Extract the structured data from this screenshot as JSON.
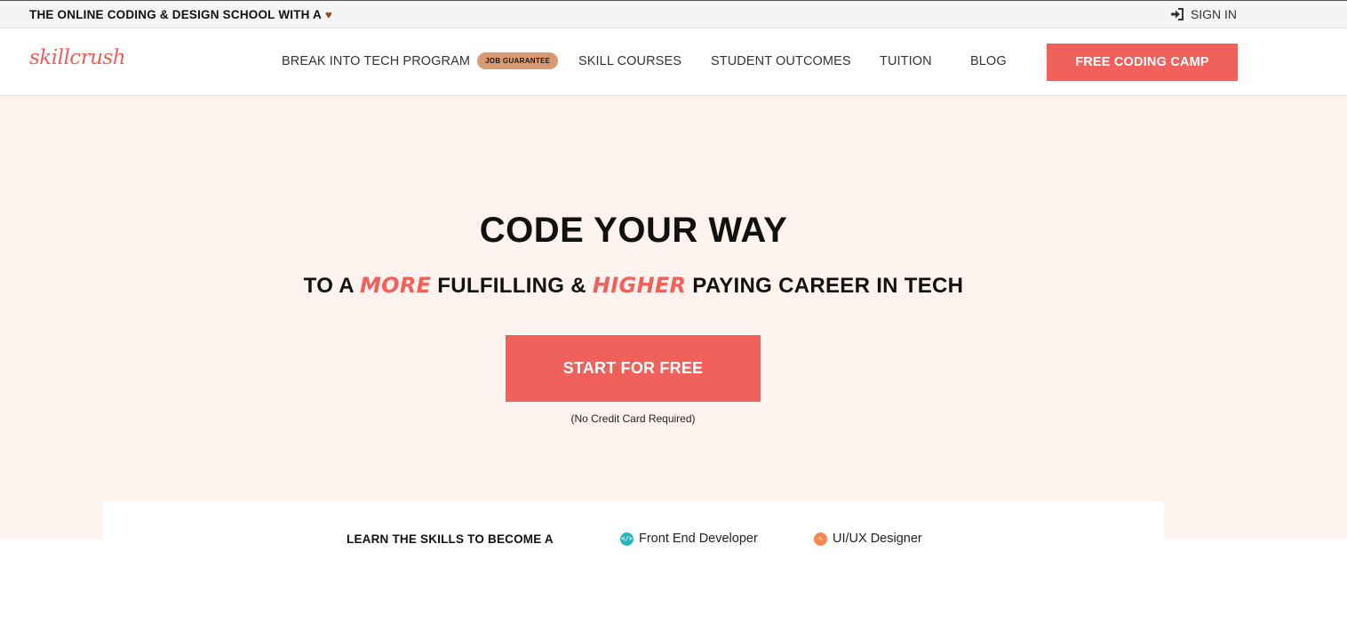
{
  "topbar": {
    "announcement": "THE ONLINE CODING & DESIGN SCHOOL WITH A",
    "heart_glyph": "♥",
    "signin_label": "SIGN IN"
  },
  "nav": {
    "logo": "skillcrush",
    "items": [
      {
        "label": "BREAK INTO TECH PROGRAM",
        "badge": "JOB GUARANTEE"
      },
      {
        "label": "SKILL COURSES"
      },
      {
        "label": "STUDENT OUTCOMES"
      },
      {
        "label": "TUITION"
      },
      {
        "label": "BLOG"
      }
    ],
    "cta_label": "FREE CODING CAMP"
  },
  "hero": {
    "title": "CODE YOUR WAY",
    "subtitle_part1": "TO A ",
    "subtitle_accent1": "MORE",
    "subtitle_part2": " FULFILLING & ",
    "subtitle_accent2": "HIGHER",
    "subtitle_part3": " PAYING CAREER IN TECH",
    "cta_label": "START FOR FREE",
    "cta_note": "(No Credit Card Required)"
  },
  "skills": {
    "label": "LEARN THE SKILLS TO BECOME A",
    "items": [
      {
        "label": "Front End Developer",
        "icon": "code-icon",
        "color": "#27b6c2"
      },
      {
        "label": "UI/UX Designer",
        "icon": "pencil-icon",
        "color": "#f5894f"
      }
    ]
  },
  "colors": {
    "accent": "#ef615a",
    "hero_background": "#fff3f0",
    "badge": "#d89a72"
  }
}
